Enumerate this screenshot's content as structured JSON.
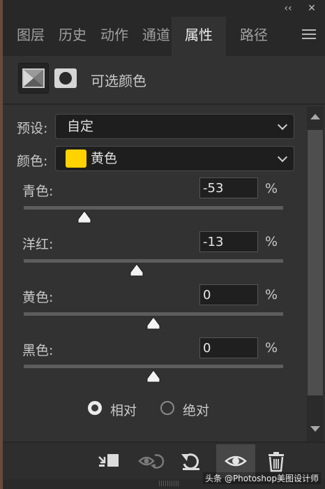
{
  "window": {
    "collapse_label": "‹‹",
    "close_label": "✕"
  },
  "tabs": [
    {
      "label": "图层",
      "active": false
    },
    {
      "label": "历史",
      "active": false
    },
    {
      "label": "动作",
      "active": false
    },
    {
      "label": "通道",
      "active": false
    },
    {
      "label": "属性",
      "active": true
    },
    {
      "label": "路径",
      "active": false
    }
  ],
  "header": {
    "title": "可选颜色"
  },
  "preset": {
    "label": "预设:",
    "value": "自定"
  },
  "color": {
    "label": "颜色:",
    "value": "黄色",
    "swatch": "#ffd200"
  },
  "sliders": [
    {
      "label": "青色:",
      "value": "-53",
      "unit": "%",
      "level": -53
    },
    {
      "label": "洋红:",
      "value": "-13",
      "unit": "%",
      "level": -13
    },
    {
      "label": "黄色:",
      "value": "0",
      "unit": "%",
      "level": 0
    },
    {
      "label": "黑色:",
      "value": "0",
      "unit": "%",
      "level": 0
    }
  ],
  "method": {
    "relative_label": "相对",
    "absolute_label": "绝对",
    "selected": "relative"
  },
  "watermark": "头条 @Photoshop美图设计师"
}
